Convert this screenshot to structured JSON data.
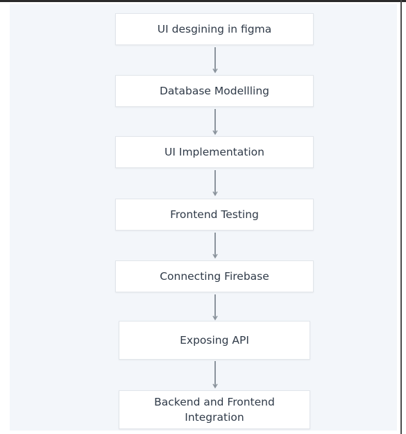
{
  "flowchart": {
    "steps": [
      "UI desgining in figma",
      "Database Modellling",
      "UI Implementation",
      "Frontend Testing",
      "Connecting Firebase",
      "Exposing API",
      "Backend and Frontend\nIntegration"
    ]
  },
  "colors": {
    "canvas_background": "#f3f6fa",
    "box_background": "#ffffff",
    "box_border": "#e1e5ea",
    "text": "#2f3a48",
    "arrow": "#8a939c"
  }
}
